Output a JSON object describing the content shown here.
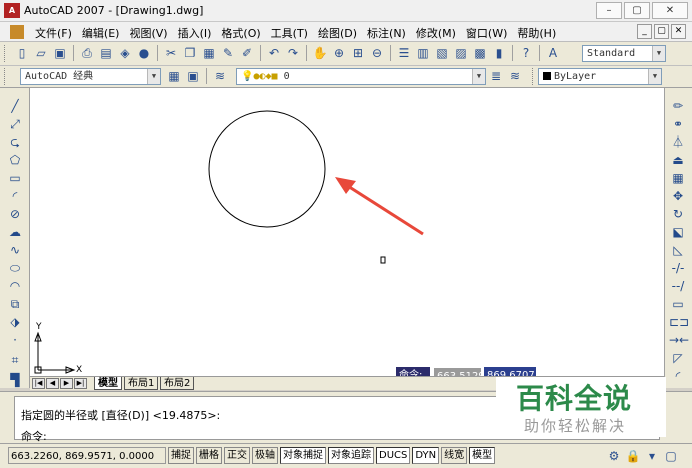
{
  "window": {
    "app_icon_text": "A",
    "title": "AutoCAD 2007 - [Drawing1.dwg]",
    "buttons": [
      "–",
      "▢",
      "✕"
    ]
  },
  "menubar": {
    "items": [
      "文件(F)",
      "编辑(E)",
      "视图(V)",
      "插入(I)",
      "格式(O)",
      "工具(T)",
      "绘图(D)",
      "标注(N)",
      "修改(M)",
      "窗口(W)",
      "帮助(H)"
    ],
    "mdi_buttons": [
      "_",
      "▢",
      "✕"
    ]
  },
  "toolbar": {
    "text_style": "Standard",
    "workspace": "AutoCAD 经典",
    "layer": "0",
    "color": "ByLayer"
  },
  "dynamic_input": {
    "label": "命令:",
    "x": "663.5129",
    "y": "869.6707"
  },
  "ucs": {
    "y_label": "Y",
    "x_label": "X"
  },
  "tabs": [
    "模型",
    "布局1",
    "布局2"
  ],
  "command": {
    "line1": "指定圆的半径或 [直径(D)] <19.4875>:",
    "line2": "命令:"
  },
  "status": {
    "coords": "663.2260, 869.9571, 0.0000",
    "buttons": [
      "捕捉",
      "栅格",
      "正交",
      "极轴",
      "对象捕捉",
      "对象追踪",
      "DUCS",
      "DYN",
      "线宽",
      "模型"
    ]
  },
  "watermark": {
    "line1": "百科全说",
    "line2": "助你轻松解决"
  },
  "colors": {
    "dyn_label_bg": "#2b2b6b",
    "dyn_active_bg": "#9a9a9a",
    "dyn_value_bg": "#2b3f8f",
    "arrow": "#e8483a",
    "watermark": "#2c8a4a"
  }
}
